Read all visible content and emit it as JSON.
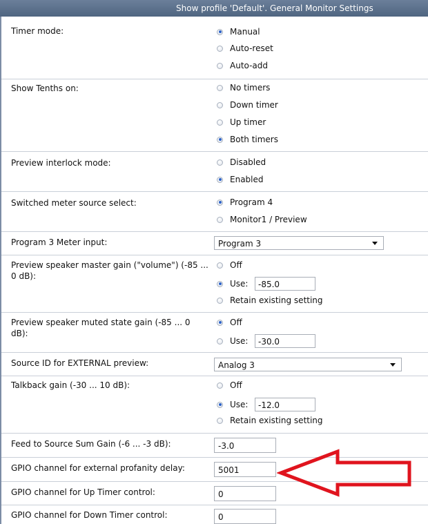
{
  "header": {
    "title": "Show profile 'Default'. General Monitor Settings"
  },
  "settings": {
    "timer_mode": {
      "label": "Timer mode:",
      "options": [
        "Manual",
        "Auto-reset",
        "Auto-add"
      ],
      "selected": "Manual"
    },
    "show_tenths": {
      "label": "Show Tenths on:",
      "options": [
        "No timers",
        "Down timer",
        "Up timer",
        "Both timers"
      ],
      "selected": "Both timers"
    },
    "preview_interlock": {
      "label": "Preview interlock mode:",
      "options": [
        "Disabled",
        "Enabled"
      ],
      "selected": "Enabled"
    },
    "switched_meter": {
      "label": "Switched meter source select:",
      "options": [
        "Program 4",
        "Monitor1 / Preview"
      ],
      "selected": "Program 4"
    },
    "program3_meter": {
      "label": "Program 3 Meter input:",
      "value": "Program 3"
    },
    "preview_master_gain": {
      "label_line1": "Preview speaker master gain (\"volume\") (-85 ...",
      "label_line2": "0 dB):",
      "off_label": "Off",
      "use_label": "Use:",
      "use_value": "-85.0",
      "retain_label": "Retain existing setting",
      "selected": "Use"
    },
    "preview_muted_gain": {
      "label_line1": "Preview speaker muted state gain (-85 ... 0",
      "label_line2": "dB):",
      "off_label": "Off",
      "use_label": "Use:",
      "use_value": "-30.0",
      "selected": "Off"
    },
    "source_id_external": {
      "label": "Source ID for EXTERNAL preview:",
      "value": "Analog 3"
    },
    "talkback_gain": {
      "label": "Talkback gain (-30 ... 10 dB):",
      "off_label": "Off",
      "use_label": "Use:",
      "use_value": "-12.0",
      "retain_label": "Retain existing setting",
      "selected": "Use"
    },
    "feed_source_sum": {
      "label": "Feed to Source Sum Gain (-6 ... -3 dB):",
      "value": "-3.0"
    },
    "gpio_profanity": {
      "label": "GPIO channel for external profanity delay:",
      "value": "5001"
    },
    "gpio_up_timer": {
      "label": "GPIO channel for Up Timer control:",
      "value": "0"
    },
    "gpio_down_timer": {
      "label": "GPIO channel for Down Timer control:",
      "value": "0"
    }
  },
  "colors": {
    "header_bg": "#5b7090",
    "radio_selected": "#2c62c8",
    "annotation_arrow": "#e0141e"
  },
  "icons": [
    "radio-button",
    "dropdown-chevron",
    "annotation-arrow"
  ]
}
